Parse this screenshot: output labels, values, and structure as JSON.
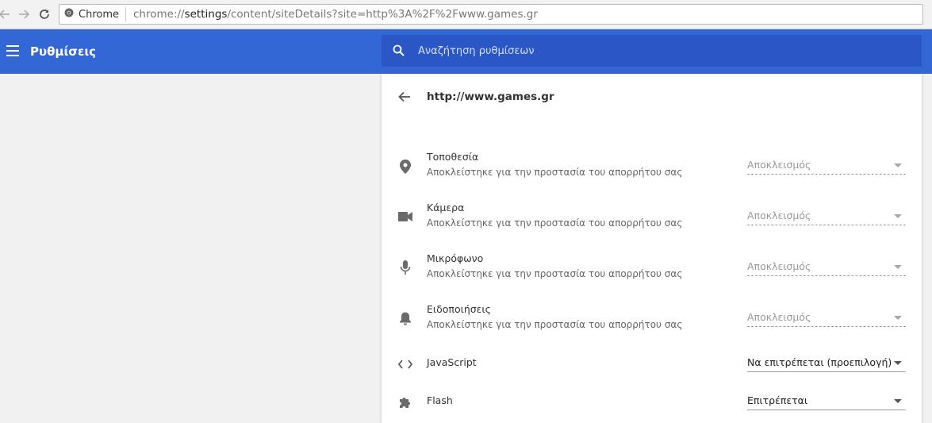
{
  "browser": {
    "chip_label": "Chrome",
    "url_prefix": "chrome://",
    "url_bold": "settings",
    "url_rest": "/content/siteDetails?site=http%3A%2F%2Fwww.games.gr"
  },
  "header": {
    "title": "Ρυθμίσεις",
    "search_placeholder": "Αναζήτηση ρυθμίσεων"
  },
  "site": {
    "title": "http://www.games.gr"
  },
  "permissions": [
    {
      "icon": "location-pin-icon",
      "label": "Τοποθεσία",
      "sub": "Αποκλείστηκε για την προστασία του απορρήτου σας",
      "value": "Αποκλεισμός",
      "disabled": true
    },
    {
      "icon": "camera-icon",
      "label": "Κάμερα",
      "sub": "Αποκλείστηκε για την προστασία του απορρήτου σας",
      "value": "Αποκλεισμός",
      "disabled": true
    },
    {
      "icon": "microphone-icon",
      "label": "Μικρόφωνο",
      "sub": "Αποκλείστηκε για την προστασία του απορρήτου σας",
      "value": "Αποκλεισμός",
      "disabled": true
    },
    {
      "icon": "bell-icon",
      "label": "Ειδοποιήσεις",
      "sub": "Αποκλείστηκε για την προστασία του απορρήτου σας",
      "value": "Αποκλεισμός",
      "disabled": true
    },
    {
      "icon": "code-brackets-icon",
      "label": "JavaScript",
      "sub": "",
      "value": "Να επιτρέπεται (προεπιλογή)",
      "disabled": false
    },
    {
      "icon": "puzzle-icon",
      "label": "Flash",
      "sub": "",
      "value": "Επιτρέπεται",
      "disabled": false
    }
  ],
  "colors": {
    "header_blue": "#3367d6",
    "search_blue": "#2a56c6"
  }
}
